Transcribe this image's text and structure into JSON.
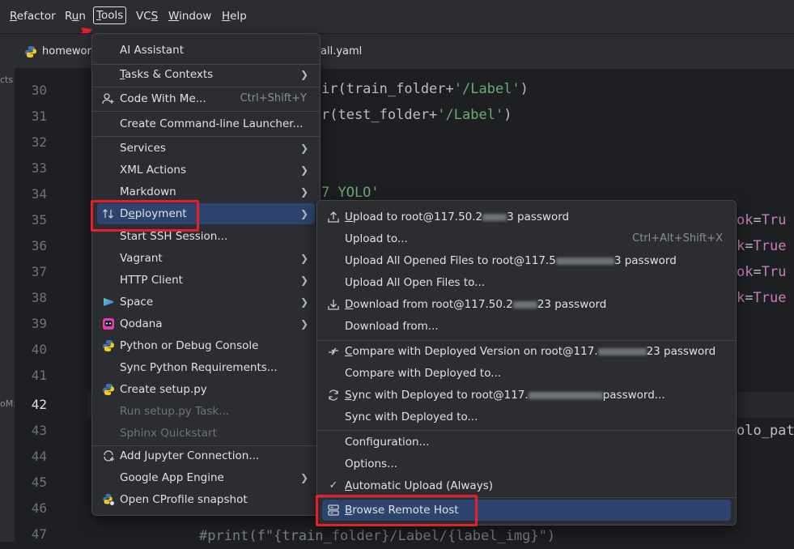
{
  "menubar": {
    "items": [
      {
        "pre": "",
        "u": "R",
        "post": "efactor"
      },
      {
        "pre": "R",
        "u": "u",
        "post": "n"
      },
      {
        "pre": "",
        "u": "T",
        "post": "ools"
      },
      {
        "pre": "VC",
        "u": "S",
        "post": ""
      },
      {
        "pre": "",
        "u": "W",
        "post": "indow"
      },
      {
        "pre": "",
        "u": "H",
        "post": "elp"
      }
    ]
  },
  "tabs": {
    "left": "homewor",
    "right": "all.yaml"
  },
  "side_text": [
    "cts",
    "oM:"
  ],
  "gutter": [
    "30",
    "31",
    "32",
    "33",
    "34",
    "35",
    "36",
    "37",
    "38",
    "39",
    "40",
    "41",
    "42",
    "43",
    "44",
    "45",
    "46",
    "47"
  ],
  "code": {
    "l30": {
      "a": "ir(train_folder+",
      "s": "'/Label'",
      "b": ")"
    },
    "l31": {
      "a": "r(test_folder+",
      "s": "'/Label'",
      "b": ")"
    },
    "l34": {
      "s": "7 YOLO'"
    },
    "r35": {
      "k": "ok",
      "e": "=",
      "v": "Tru"
    },
    "r36": {
      "k": "k",
      "e": "=",
      "v": "True"
    },
    "r37": {
      "k": "ok",
      "e": "=",
      "v": "Tru"
    },
    "r38": {
      "k": "k",
      "e": "=",
      "v": "True"
    },
    "r43": "olo_pat",
    "l47": "#print(f\"{train_folder}/Label/{label_img}\")"
  },
  "tools_menu": {
    "items": [
      {
        "label": "AI Assistant"
      },
      {
        "label": "Tasks & Contexts",
        "u": "T",
        "rest": "asks & Contexts"
      },
      {
        "label": "Code With Me...",
        "shortcut": "Ctrl+Shift+Y",
        "icon": "person-plus-icon"
      },
      {
        "label": "Create Command-line Launcher..."
      },
      {
        "label": "Services"
      },
      {
        "label": "XML Actions"
      },
      {
        "label": "Markdown"
      },
      {
        "label": "Deployment",
        "u_pre": "D",
        "u": "e",
        "rest": "ployment",
        "icon": "deployment-icon"
      },
      {
        "label": "Start SSH Session..."
      },
      {
        "label": "Vagrant"
      },
      {
        "label": "HTTP Client"
      },
      {
        "label": "Space",
        "icon": "space-icon"
      },
      {
        "label": "Qodana",
        "icon": "qodana-icon"
      },
      {
        "label": "Python or Debug Console",
        "icon": "python-icon"
      },
      {
        "label": "Sync Python Requirements..."
      },
      {
        "label": "Create setup.py",
        "icon": "python-icon"
      },
      {
        "label": "Run setup.py Task..."
      },
      {
        "label": "Sphinx Quickstart"
      },
      {
        "label": "Add Jupyter Connection...",
        "icon": "jupyter-icon"
      },
      {
        "label": "Google App Engine"
      },
      {
        "label": "Open CProfile snapshot",
        "icon": "cprofile-icon"
      }
    ]
  },
  "deploy_menu": {
    "items": [
      {
        "pre": "U",
        "rest": "pload to root@117.50.2",
        "tail": "3 password",
        "icon": "upload-icon"
      },
      {
        "label": "Upload to...",
        "shortcut": "Ctrl+Alt+Shift+X"
      },
      {
        "pre": "Upload All Opened Files to root@117.5",
        "tail": "3 password"
      },
      {
        "label": "Upload All Open Files to..."
      },
      {
        "pre": "D",
        "rest": "ownload from root@117.50.2",
        "tail": "23 password",
        "icon": "download-icon"
      },
      {
        "label": "Download from..."
      },
      {
        "pre": "C",
        "rest": "ompare with Deployed Version on root@117.",
        "tail": "23 password",
        "icon": "compare-icon"
      },
      {
        "label": "Compare with Deployed to..."
      },
      {
        "pre": "S",
        "rest": "ync with Deployed to root@117.",
        "tail": "password...",
        "icon": "sync-icon"
      },
      {
        "label": "Sync with Deployed to..."
      },
      {
        "label": "Configuration..."
      },
      {
        "label": "Options..."
      },
      {
        "pre": "A",
        "rest": "utomatic Upload (Always)",
        "icon": "check-icon"
      },
      {
        "pre": "B",
        "rest": "rowse Remote Host",
        "icon": "server-icon"
      }
    ]
  },
  "colors": {
    "accent_selection": "#2e436e",
    "highlight_box": "#e5202b",
    "annotation_arrow": "#e5202b"
  }
}
